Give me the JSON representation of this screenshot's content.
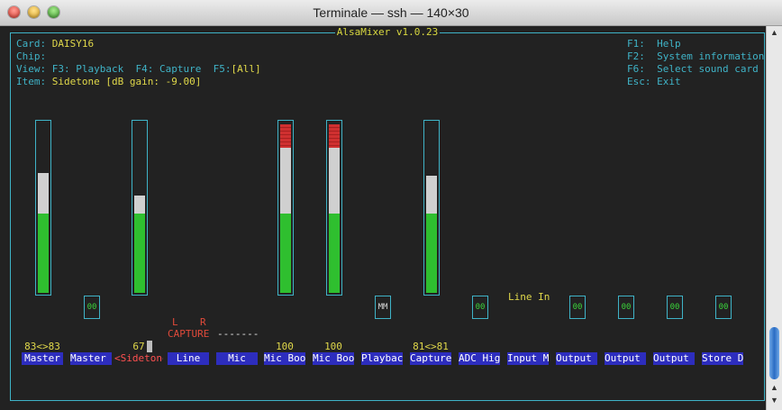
{
  "window": {
    "title": "Terminale — ssh — 140×30"
  },
  "mixer": {
    "title": "AlsaMixer v1.0.23",
    "card_label": "Card:",
    "card_value": "DAISY16",
    "chip_label": "Chip:",
    "view_label": "View:",
    "view_f3": "F3: Playback",
    "view_f4": "F4: Capture",
    "view_f5": "F5:",
    "view_all": "[All]",
    "item_label": "Item:",
    "item_value": "Sidetone [dB gain: -9.00]",
    "help": [
      "F1:  Help",
      "F2:  System information",
      "F6:  Select sound card",
      "Esc: Exit"
    ],
    "channels": [
      {
        "label": "Master",
        "value": "83<>83",
        "level": 0.83,
        "red": 0
      },
      {
        "label": "Master P",
        "value": "",
        "level": null,
        "red": 0
      },
      {
        "label": "Sidetone",
        "value": "67",
        "level": 0.67,
        "red": 0
      },
      {
        "label": "Line",
        "value": "",
        "level": null,
        "red": 0
      },
      {
        "label": "Mic",
        "value": "",
        "level": null,
        "red": 0
      },
      {
        "label": "Mic Boos",
        "value": "100",
        "level": 1.0,
        "red": 1
      },
      {
        "label": "Mic Boos",
        "value": "100",
        "level": 1.0,
        "red": 1
      },
      {
        "label": "Playback",
        "value": "",
        "level": null,
        "red": 0
      },
      {
        "label": "Capture",
        "value": "81<>81",
        "level": 0.81,
        "red": 0
      },
      {
        "label": "ADC High",
        "value": "",
        "level": null,
        "red": 0
      },
      {
        "label": "Input Mu",
        "value": "",
        "level": null,
        "red": 0
      },
      {
        "label": "Output M",
        "value": "",
        "level": null,
        "red": 0
      },
      {
        "label": "Output M",
        "value": "",
        "level": null,
        "red": 0
      },
      {
        "label": "Output M",
        "value": "",
        "level": null,
        "red": 0
      },
      {
        "label": "Store DC",
        "value": "",
        "level": null,
        "red": 0
      }
    ],
    "switches": [
      "00",
      "MM",
      "00",
      "00",
      "00",
      "00",
      "00"
    ],
    "line_in_label": "Line In",
    "capture_l": "L",
    "capture_r": "R",
    "capture_label": "CAPTURE",
    "capture_dashes": "-------",
    "sel_left": "<",
    "sel_right": ">",
    "colors": {
      "frame": "#3fb3c7",
      "text": "#e0d84a",
      "green": "#2fbf2f",
      "white": "#d0d0d0",
      "red": "#d03030",
      "label_bg": "#2d2dbe"
    }
  }
}
